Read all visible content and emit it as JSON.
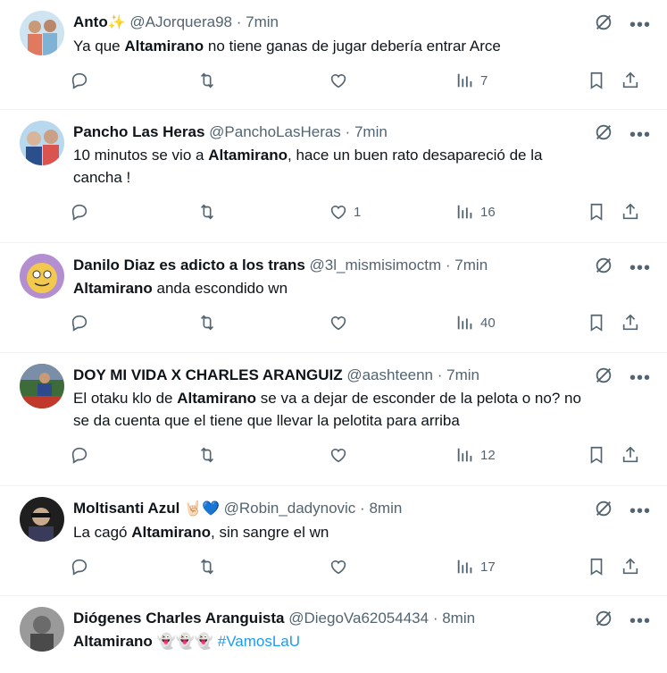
{
  "tweets": [
    {
      "name": "Anto",
      "name_emoji": "✨",
      "handle": "@AJorquera98",
      "time": "7min",
      "text_before": "Ya que ",
      "text_bold": "Altamirano",
      "text_after": " no tiene ganas de jugar debería entrar Arce",
      "likes": "",
      "views": "7",
      "avatar_colors": [
        "#7fb3d5",
        "#e07a5f"
      ]
    },
    {
      "name": "Pancho Las Heras",
      "name_emoji": "",
      "handle": "@PanchoLasHeras",
      "time": "7min",
      "text_before": "10 minutos se vio a ",
      "text_bold": "Altamirano",
      "text_after": ", hace un buen rato desapareció de la cancha !",
      "likes": "1",
      "views": "16",
      "avatar_colors": [
        "#9ec9e8",
        "#d9534f"
      ]
    },
    {
      "name": "Danilo Diaz es adicto a los trans",
      "name_emoji": "",
      "handle": "@3l_mismisimoctm",
      "time": "7min",
      "text_before": "",
      "text_bold": "Altamirano",
      "text_after": " anda escondido wn",
      "likes": "",
      "views": "40",
      "avatar_colors": [
        "#f2c94c",
        "#b38fd1"
      ]
    },
    {
      "name": "DOY MI VIDA X CHARLES ARANGUIZ",
      "name_emoji": "",
      "handle": "@aashteenn",
      "time": "7min",
      "text_before": "El otaku klo de ",
      "text_bold": "Altamirano",
      "text_after": " se va a dejar de esconder de la pelota o no? no se da cuenta que el tiene que llevar la pelotita para arriba",
      "likes": "",
      "views": "12",
      "avatar_colors": [
        "#2e4a8c",
        "#c0392b"
      ]
    },
    {
      "name": "Moltisanti Azul",
      "name_emoji": "🤘🏻💙",
      "handle": "@Robin_dadynovic",
      "time": "8min",
      "text_before": "La cagó ",
      "text_bold": "Altamirano",
      "text_after": ", sin sangre el wn",
      "likes": "",
      "views": "17",
      "avatar_colors": [
        "#2d2d2d",
        "#8a8a8a"
      ]
    },
    {
      "name": "Diógenes Charles Aranguista",
      "name_emoji": "",
      "handle": "@DiegoVa62054434",
      "time": "8min",
      "text_before": "",
      "text_bold": "Altamirano",
      "text_after": " 👻👻👻 ",
      "hashtag": "#VamosLaU",
      "likes": "",
      "views": "",
      "avatar_colors": [
        "#6b6b6b",
        "#bdbdbd"
      ]
    }
  ],
  "ui": {
    "separator": "·",
    "more": "•••",
    "icons": [
      "grok-icon",
      "more-icon",
      "reply-icon",
      "retweet-icon",
      "like-icon",
      "views-icon",
      "bookmark-icon",
      "share-icon"
    ]
  }
}
